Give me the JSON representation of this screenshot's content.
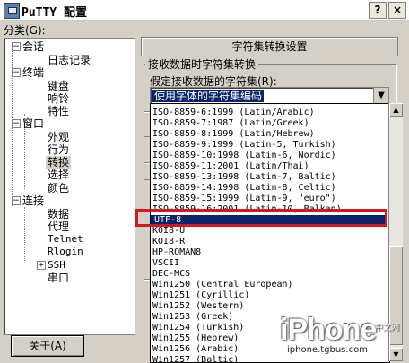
{
  "window": {
    "title": "PuTTY 配置",
    "help_glyph": "?",
    "close_glyph": "×"
  },
  "sidebar": {
    "category_label": "分类(G):",
    "items": [
      {
        "label": "会话",
        "expander": "−"
      },
      {
        "label": "日志记录"
      },
      {
        "label": "终端",
        "expander": "−"
      },
      {
        "label": "键盘"
      },
      {
        "label": "响铃"
      },
      {
        "label": "特性"
      },
      {
        "label": "窗口",
        "expander": "−"
      },
      {
        "label": "外观"
      },
      {
        "label": "行为"
      },
      {
        "label": "转换",
        "selected": true
      },
      {
        "label": "选择"
      },
      {
        "label": "颜色"
      },
      {
        "label": "连接",
        "expander": "−"
      },
      {
        "label": "数据"
      },
      {
        "label": "代理"
      },
      {
        "label": "Telnet"
      },
      {
        "label": "Rlogin"
      },
      {
        "label": "SSH",
        "expander": "+"
      },
      {
        "label": "串口"
      }
    ],
    "about_button": "关于(A)"
  },
  "main": {
    "section_title": "字符集转换设置",
    "group_title": "接收数据时字符集转换",
    "encoding_label": "假定接收数据的字符集(R):",
    "encoding_value": "使用字体的字符集编码",
    "combo_arrow": "▼",
    "charsets": [
      "ISO-8859-6:1999 (Latin/Arabic)",
      "ISO-8859-7:1987 (Latin/Greek)",
      "ISO-8859-8:1999 (Latin/Hebrew)",
      "ISO-8859-9:1999 (Latin-5, Turkish)",
      "ISO-8859-10:1998 (Latin-6, Nordic)",
      "ISO-8859-11:2001 (Latin/Thai)",
      "ISO-8859-13:1998 (Latin-7, Baltic)",
      "ISO-8859-14:1998 (Latin-8, Celtic)",
      "ISO-8859-15:1999 (Latin-9, \"euro\")",
      "ISO-8859-16:2001 (Latin-10, Balkan)",
      "UTF-8",
      "KOI8-U",
      "KOI8-R",
      "HP-ROMAN8",
      "VSCII",
      "DEC-MCS",
      "Win1250 (Central European)",
      "Win1251 (Cyrillic)",
      "Win1252 (Western)",
      "Win1253 (Greek)",
      "Win1254 (Turkish)",
      "Win1255 (Hebrew)",
      "Win1256 (Arabic)",
      "Win1257 (Baltic)"
    ],
    "selected_charset": "UTF-8",
    "scroll_up": "▲",
    "scroll_down": "▼"
  },
  "watermark": {
    "brand": "iPhone",
    "cn": "中文网",
    "url": "iphone.tgbus.com"
  }
}
